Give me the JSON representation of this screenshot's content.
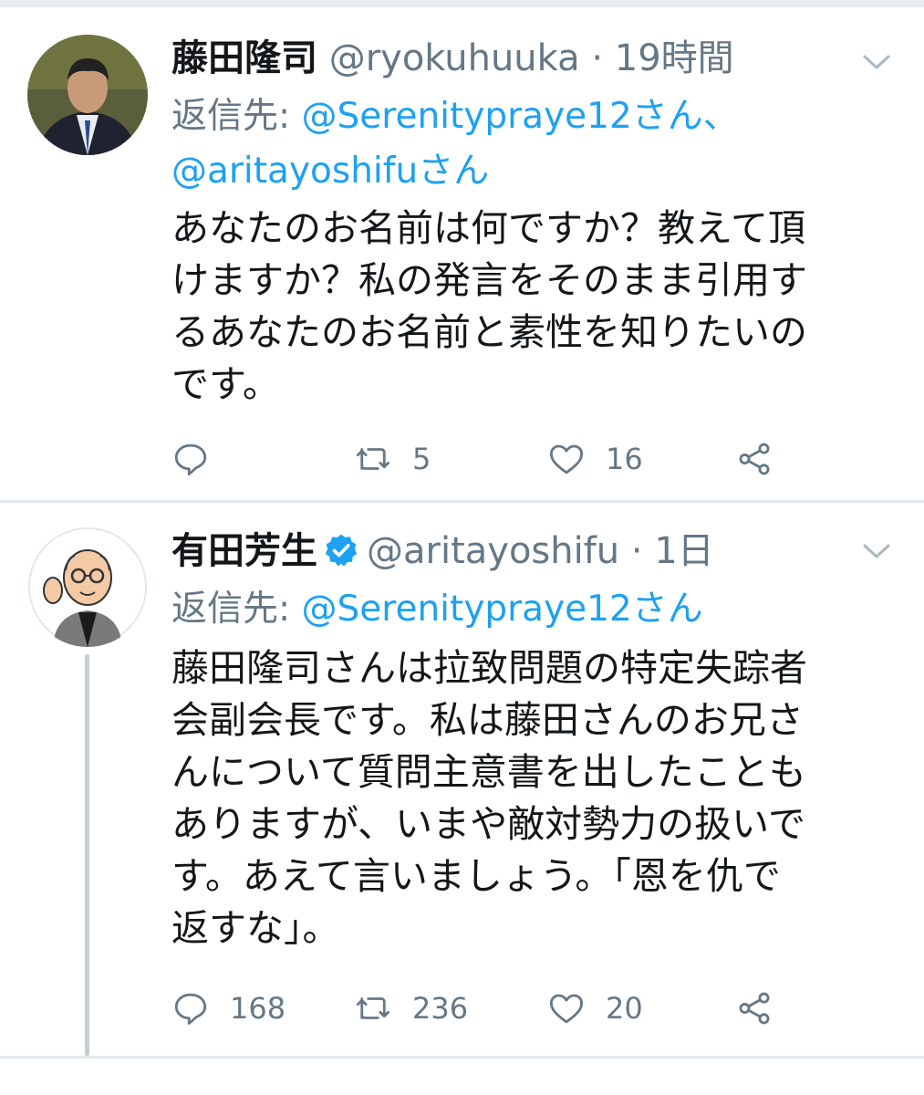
{
  "tweets": [
    {
      "name": "藤田隆司",
      "handle": "@ryokuhuuka",
      "separator": "·",
      "time": "19時間",
      "verified": false,
      "reply_prefix": "返信先:",
      "reply_to": [
        "@Serenitypraye12さん、",
        "@aritayoshifuさん"
      ],
      "text_lines": [
        "あなたのお名前は何ですか？教えて頂",
        "けますか？私の発言をそのまま引用す",
        "るあなたのお名前と素性を知りたいの",
        "です。"
      ],
      "stats": {
        "replies": "",
        "retweets": "5",
        "likes": "16"
      }
    },
    {
      "name": "有田芳生",
      "handle": "@aritayoshifu",
      "separator": "·",
      "time": "1日",
      "verified": true,
      "reply_prefix": "返信先:",
      "reply_to": [
        "@Serenitypraye12さん"
      ],
      "text_lines": [
        "藤田隆司さんは拉致問題の特定失踪者",
        "会副会長です。私は藤田さんのお兄さ",
        "んについて質問主意書を出したことも",
        "ありますが、いまや敵対勢力の扱いで",
        "す。あえて言いましょう。「恩を仇で",
        "返すな」。"
      ],
      "stats": {
        "replies": "168",
        "retweets": "236",
        "likes": "20"
      }
    }
  ],
  "colors": {
    "accent": "#1da1f2",
    "secondary_text": "#657786",
    "divider": "#e1e8ed"
  },
  "icons": [
    "reply-icon",
    "retweet-icon",
    "like-icon",
    "share-icon",
    "chevron-down-icon",
    "verified-badge-icon"
  ]
}
